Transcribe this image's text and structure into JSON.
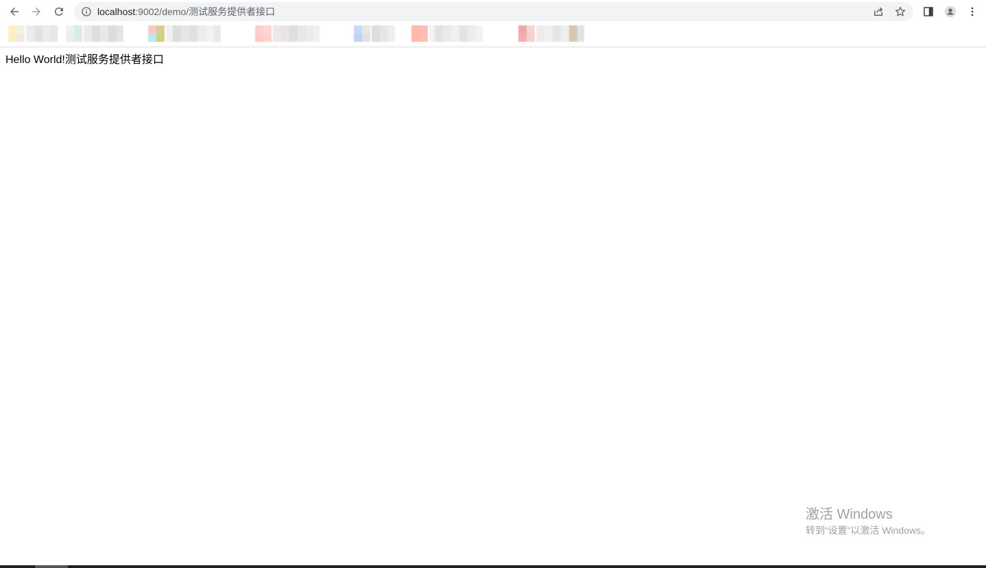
{
  "browser": {
    "url_host": "localhost",
    "url_path": ":9002/demo/测试服务提供者接口",
    "icons": {
      "back": "arrow-left-icon",
      "forward": "arrow-right-icon",
      "reload": "reload-icon",
      "info": "info-icon",
      "share": "share-icon",
      "bookmark_star": "star-icon",
      "side_panel": "side-panel-icon",
      "profile": "profile-icon",
      "menu": "kebab-menu-icon"
    },
    "colors": {
      "omnibox_bg": "#f1f3f4",
      "icon": "#5f6368",
      "icon_disabled": "#9aa0a6"
    }
  },
  "page": {
    "body_text": "Hello World!测试服务提供者接口"
  },
  "watermark": {
    "title": "激活 Windows",
    "subtitle": "转到“设置”以激活 Windows。"
  }
}
